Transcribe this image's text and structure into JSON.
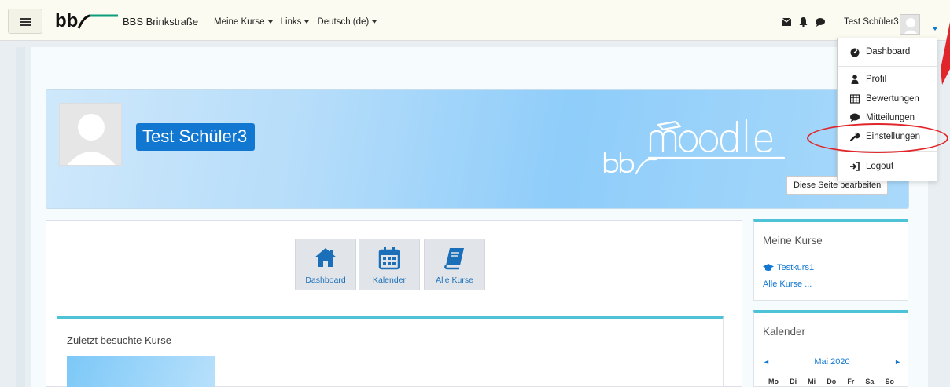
{
  "navbar": {
    "site_name": "BBS Brinkstraße",
    "menus": [
      "Meine Kurse",
      "Links",
      "Deutsch (de)"
    ],
    "user_name": "Test Schüler3",
    "icons": [
      "envelope-icon",
      "bell-icon",
      "chat-icon"
    ]
  },
  "dropdown": {
    "items": [
      {
        "label": "Dashboard",
        "icon": "dashboard-icon"
      },
      {
        "label": "Profil",
        "icon": "user-icon"
      },
      {
        "label": "Bewertungen",
        "icon": "table-icon"
      },
      {
        "label": "Mitteilungen",
        "icon": "chat-icon"
      },
      {
        "label": "Einstellungen",
        "icon": "wrench-icon"
      },
      {
        "label": "Logout",
        "icon": "logout-icon"
      }
    ]
  },
  "banner": {
    "user_name": "Test Schüler3",
    "edit_button": "Diese Seite bearbeiten"
  },
  "quick_links": [
    {
      "label": "Dashboard",
      "icon": "home-icon"
    },
    {
      "label": "Kalender",
      "icon": "calendar-icon"
    },
    {
      "label": "Alle Kurse",
      "icon": "book-icon"
    }
  ],
  "recent": {
    "title": "Zuletzt besuchte Kurse"
  },
  "my_courses": {
    "title": "Meine Kurse",
    "course": "Testkurs1",
    "all_courses": "Alle Kurse ..."
  },
  "calendar": {
    "title": "Kalender",
    "month": "Mai 2020",
    "days": [
      "Mo",
      "Di",
      "Mi",
      "Do",
      "Fr",
      "Sa",
      "So"
    ]
  },
  "colors": {
    "accent": "#1177d1",
    "block_top": "#4ec2d6",
    "annotation": "#e0262b"
  }
}
